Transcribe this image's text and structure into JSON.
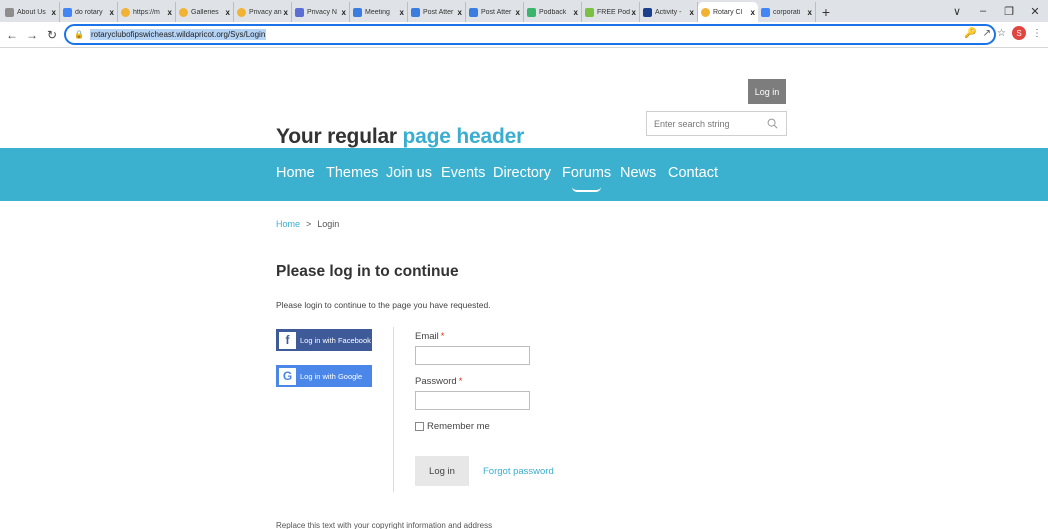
{
  "browser": {
    "tabs": [
      {
        "title": "About Us",
        "icon": "page-icon",
        "color": "#8d8d8d",
        "active": false
      },
      {
        "title": "do rotary",
        "icon": "google-icon",
        "color": "#4285f4",
        "active": false
      },
      {
        "title": "https://m",
        "icon": "rotary-icon",
        "color": "#f2b233",
        "active": false
      },
      {
        "title": "Galleries",
        "icon": "rotary-icon",
        "color": "#f2b233",
        "active": false
      },
      {
        "title": "Privacy an",
        "icon": "rotary-icon",
        "color": "#f2b233",
        "active": false
      },
      {
        "title": "Privacy N",
        "icon": "doc-icon",
        "color": "#5a6ed6",
        "active": false
      },
      {
        "title": "Meeting",
        "icon": "square-icon",
        "color": "#3b7de0",
        "active": false
      },
      {
        "title": "Post Atter",
        "icon": "square-icon",
        "color": "#3b7de0",
        "active": false
      },
      {
        "title": "Post Atter",
        "icon": "square-icon",
        "color": "#3b7de0",
        "active": false
      },
      {
        "title": "Podback",
        "icon": "leaf-icon",
        "color": "#3bb56b",
        "active": false
      },
      {
        "title": "FREE Pod",
        "icon": "dash-icon",
        "color": "#7bc043",
        "active": false
      },
      {
        "title": "Activity -",
        "icon": "p-icon",
        "color": "#1c3f8c",
        "active": false
      },
      {
        "title": "Rotary Cl",
        "icon": "rotary-icon",
        "color": "#f2b233",
        "active": true
      },
      {
        "title": "corporati",
        "icon": "google-icon",
        "color": "#4285f4",
        "active": false
      }
    ],
    "new_tab": "+",
    "close_glyph": "x",
    "url": "rotaryclubofipswicheast.wildapricot.org/Sys/Login",
    "profile_initial": "S"
  },
  "header": {
    "title_plain": "Your regular",
    "title_accent": "page header",
    "login_label": "Log in",
    "search_placeholder": "Enter search string"
  },
  "nav": {
    "active": "Forums",
    "items": [
      "Home",
      "Themes",
      "Join us",
      "Events",
      "Directory",
      "Forums",
      "News",
      "Contact"
    ]
  },
  "breadcrumb": {
    "home": "Home",
    "separator": ">",
    "current": "Login"
  },
  "content": {
    "heading": "Please log in to continue",
    "intro": "Please login to continue to the page you have requested.",
    "facebook_label": "Log in with Facebook",
    "google_label": "Log in with Google",
    "email_label": "Email",
    "password_label": "Password",
    "required_mark": "*",
    "remember_label": "Remember me",
    "submit_label": "Log in",
    "forgot_label": "Forgot password"
  },
  "footer": {
    "text": "Replace this text with your copyright information and address"
  },
  "colors": {
    "accent": "#3aaed0",
    "navbar": "#3cb1cf",
    "facebook": "#3e5a99",
    "google": "#4a87e8",
    "required": "#d9341d"
  }
}
